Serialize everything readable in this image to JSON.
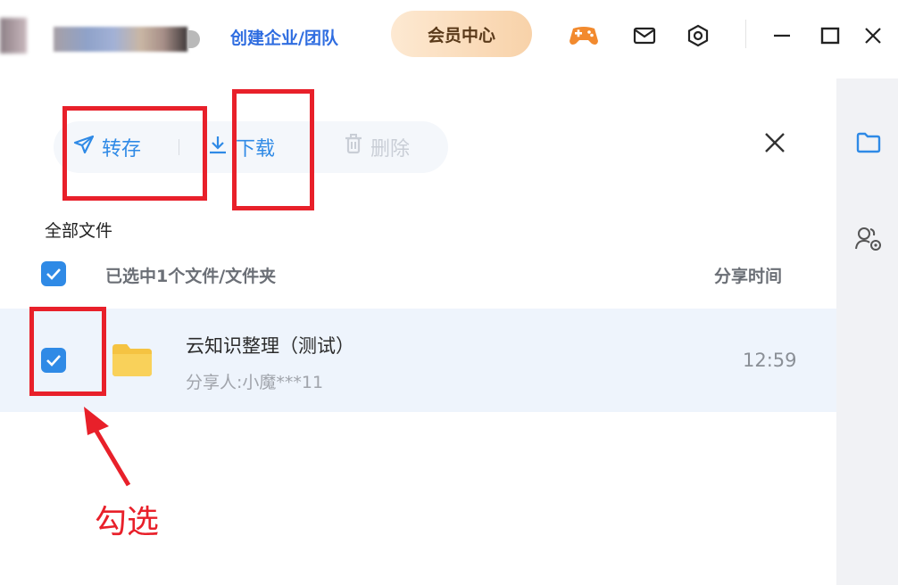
{
  "titlebar": {
    "team_link": "创建企业/团队",
    "vip_button": "会员中心",
    "icons": [
      "game-icon",
      "mail-icon",
      "settings-icon",
      "minimize-icon",
      "maximize-icon",
      "close-icon"
    ]
  },
  "toolbar": {
    "transfer_label": "转存",
    "download_label": "下载",
    "delete_label": "删除"
  },
  "list": {
    "breadcrumb": "全部文件",
    "selection_text": "已选中1个文件/文件夹",
    "time_header": "分享时间",
    "rows": [
      {
        "name": "云知识整理（测试）",
        "owner": "分享人:小魔***11",
        "time": "12:59",
        "checked": true
      }
    ]
  },
  "annotation": {
    "label": "勾选"
  },
  "colors": {
    "accent": "#2f8ae6",
    "annotation": "#e8202a",
    "selected_row": "#eef4fc",
    "folder": "#f7c844"
  }
}
